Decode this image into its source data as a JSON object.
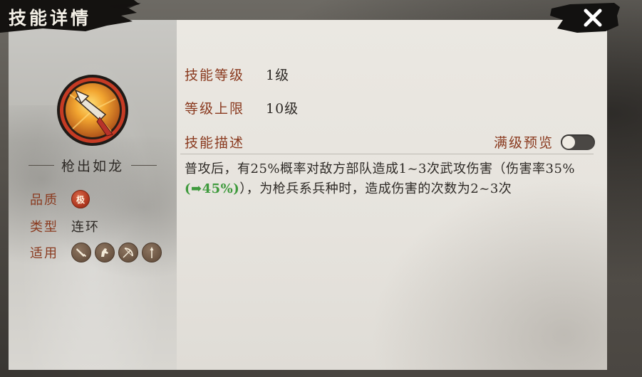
{
  "window": {
    "title": "技能详情",
    "close_icon": "close-icon"
  },
  "skill": {
    "name": "枪出如龙",
    "icon": "spear-tip-icon",
    "attributes": {
      "quality_label": "品质",
      "quality_value": "极",
      "type_label": "类型",
      "type_value": "连环",
      "applies_label": "适用",
      "applies_icons": [
        "sword-unit-icon",
        "cavalry-unit-icon",
        "bow-unit-icon",
        "spear-unit-icon"
      ]
    }
  },
  "details": {
    "level_label": "技能等级",
    "level_value": "1级",
    "max_level_label": "等级上限",
    "max_level_value": "10级",
    "desc_label": "技能描述",
    "max_preview_label": "满级预览",
    "max_preview_on": false,
    "desc_part1": "普攻后，有25%概率对敌方部队造成1~3次武攻伤害（伤害率35%",
    "desc_bonus": "(➡45%)",
    "desc_part2": "），为枪兵系兵种时，造成伤害的次数为2~3次"
  },
  "colors": {
    "label": "#8a3a1f",
    "text": "#2e2a26",
    "bonus": "#3e9a3c",
    "quality_badge": "#b23a22"
  }
}
